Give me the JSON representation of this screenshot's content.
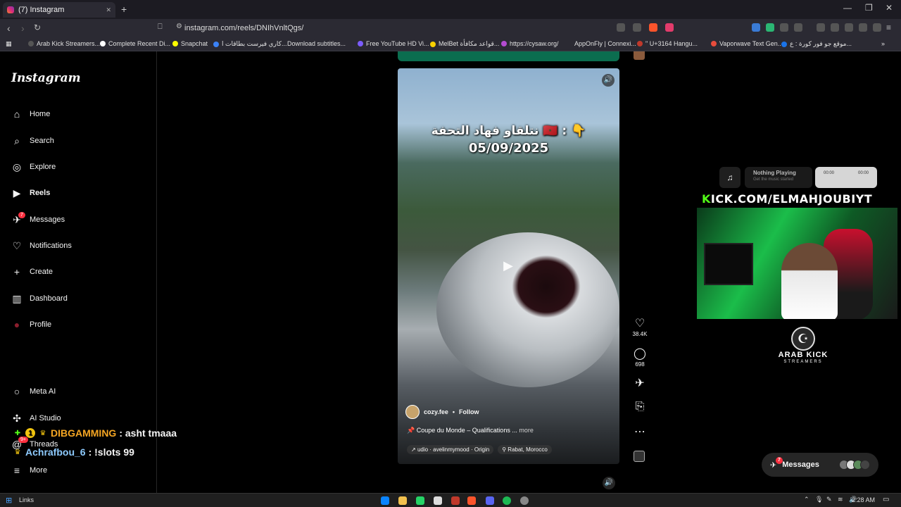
{
  "browser": {
    "tab_title": "(7) Instagram",
    "url": "instagram.com/reels/DNIhVnltQgs/",
    "new_tab": "+",
    "close_tab": "✕",
    "window_controls": [
      "—",
      "❐",
      "✕"
    ],
    "bookmarks": [
      "Arab Kick Streamers...",
      "Complete Recent Di...",
      "Snapchat",
      "كاري فيرست بطاقات ا...",
      "Download subtitles...",
      "Free YouTube HD Vi...",
      "MelBet قواعد مكافأة...",
      "https://cysaw.org/",
      "AppOnFly | Connexi...",
      "\" U+3164 Hangu...",
      "Vaporwave Text Gen...",
      "موقع جو فور كورة : ع..."
    ]
  },
  "sidebar": {
    "logo": "Instagram",
    "items": [
      {
        "label": "Home",
        "icon": "⌂"
      },
      {
        "label": "Search",
        "icon": "⌕"
      },
      {
        "label": "Explore",
        "icon": "◎"
      },
      {
        "label": "Reels",
        "icon": "▶"
      },
      {
        "label": "Messages",
        "icon": "✈",
        "badge": "7"
      },
      {
        "label": "Notifications",
        "icon": "♡"
      },
      {
        "label": "Create",
        "icon": "+"
      },
      {
        "label": "Dashboard",
        "icon": "▥"
      },
      {
        "label": "Profile",
        "icon": "●"
      }
    ],
    "bottom_items": [
      {
        "label": "Meta AI",
        "icon": "○"
      },
      {
        "label": "AI Studio",
        "icon": "✣"
      },
      {
        "label": "Threads",
        "icon": "@",
        "badge": "9+"
      },
      {
        "label": "More",
        "icon": "≡"
      }
    ]
  },
  "reel": {
    "overlay_arabic": "نتلقاو فهاد التحفة 🇲🇦 : 👇",
    "overlay_date": "05/09/2025",
    "author": "cozy.fee",
    "separator": "•",
    "follow": "Follow",
    "caption": "Coupe du Monde – Qualifications ...",
    "caption_more": "more",
    "audio": "udio · avelinmymood · Origin",
    "location": "Rabat, Morocco",
    "likes": "38.4K",
    "comments": "698"
  },
  "stream_overlay": {
    "np_title": "Nothing Playing",
    "np_sub": "Get the music started",
    "np_time_start": "00:00",
    "np_time_end": "00:00",
    "kick_url_first": "K",
    "kick_url_rest": "ICK.COM/ELMAHJOUBIYT",
    "logo_name": "ARAB KICK",
    "logo_sub": "STREAMERS"
  },
  "messages_pill": {
    "label": "Messages",
    "badge": "7"
  },
  "chat": [
    {
      "user": "DIBGAMMING",
      "text": ": asht tmaaa",
      "color": "#f5a623",
      "badge": "1"
    },
    {
      "user": "Achrafbou_6",
      "text": ": !slots 99",
      "color": "#8ecbff"
    }
  ],
  "taskbar": {
    "links": "Links",
    "time": "2:28 AM"
  },
  "colors": {
    "kick_green": "#53fc18",
    "notification_red": "#ff3040"
  }
}
